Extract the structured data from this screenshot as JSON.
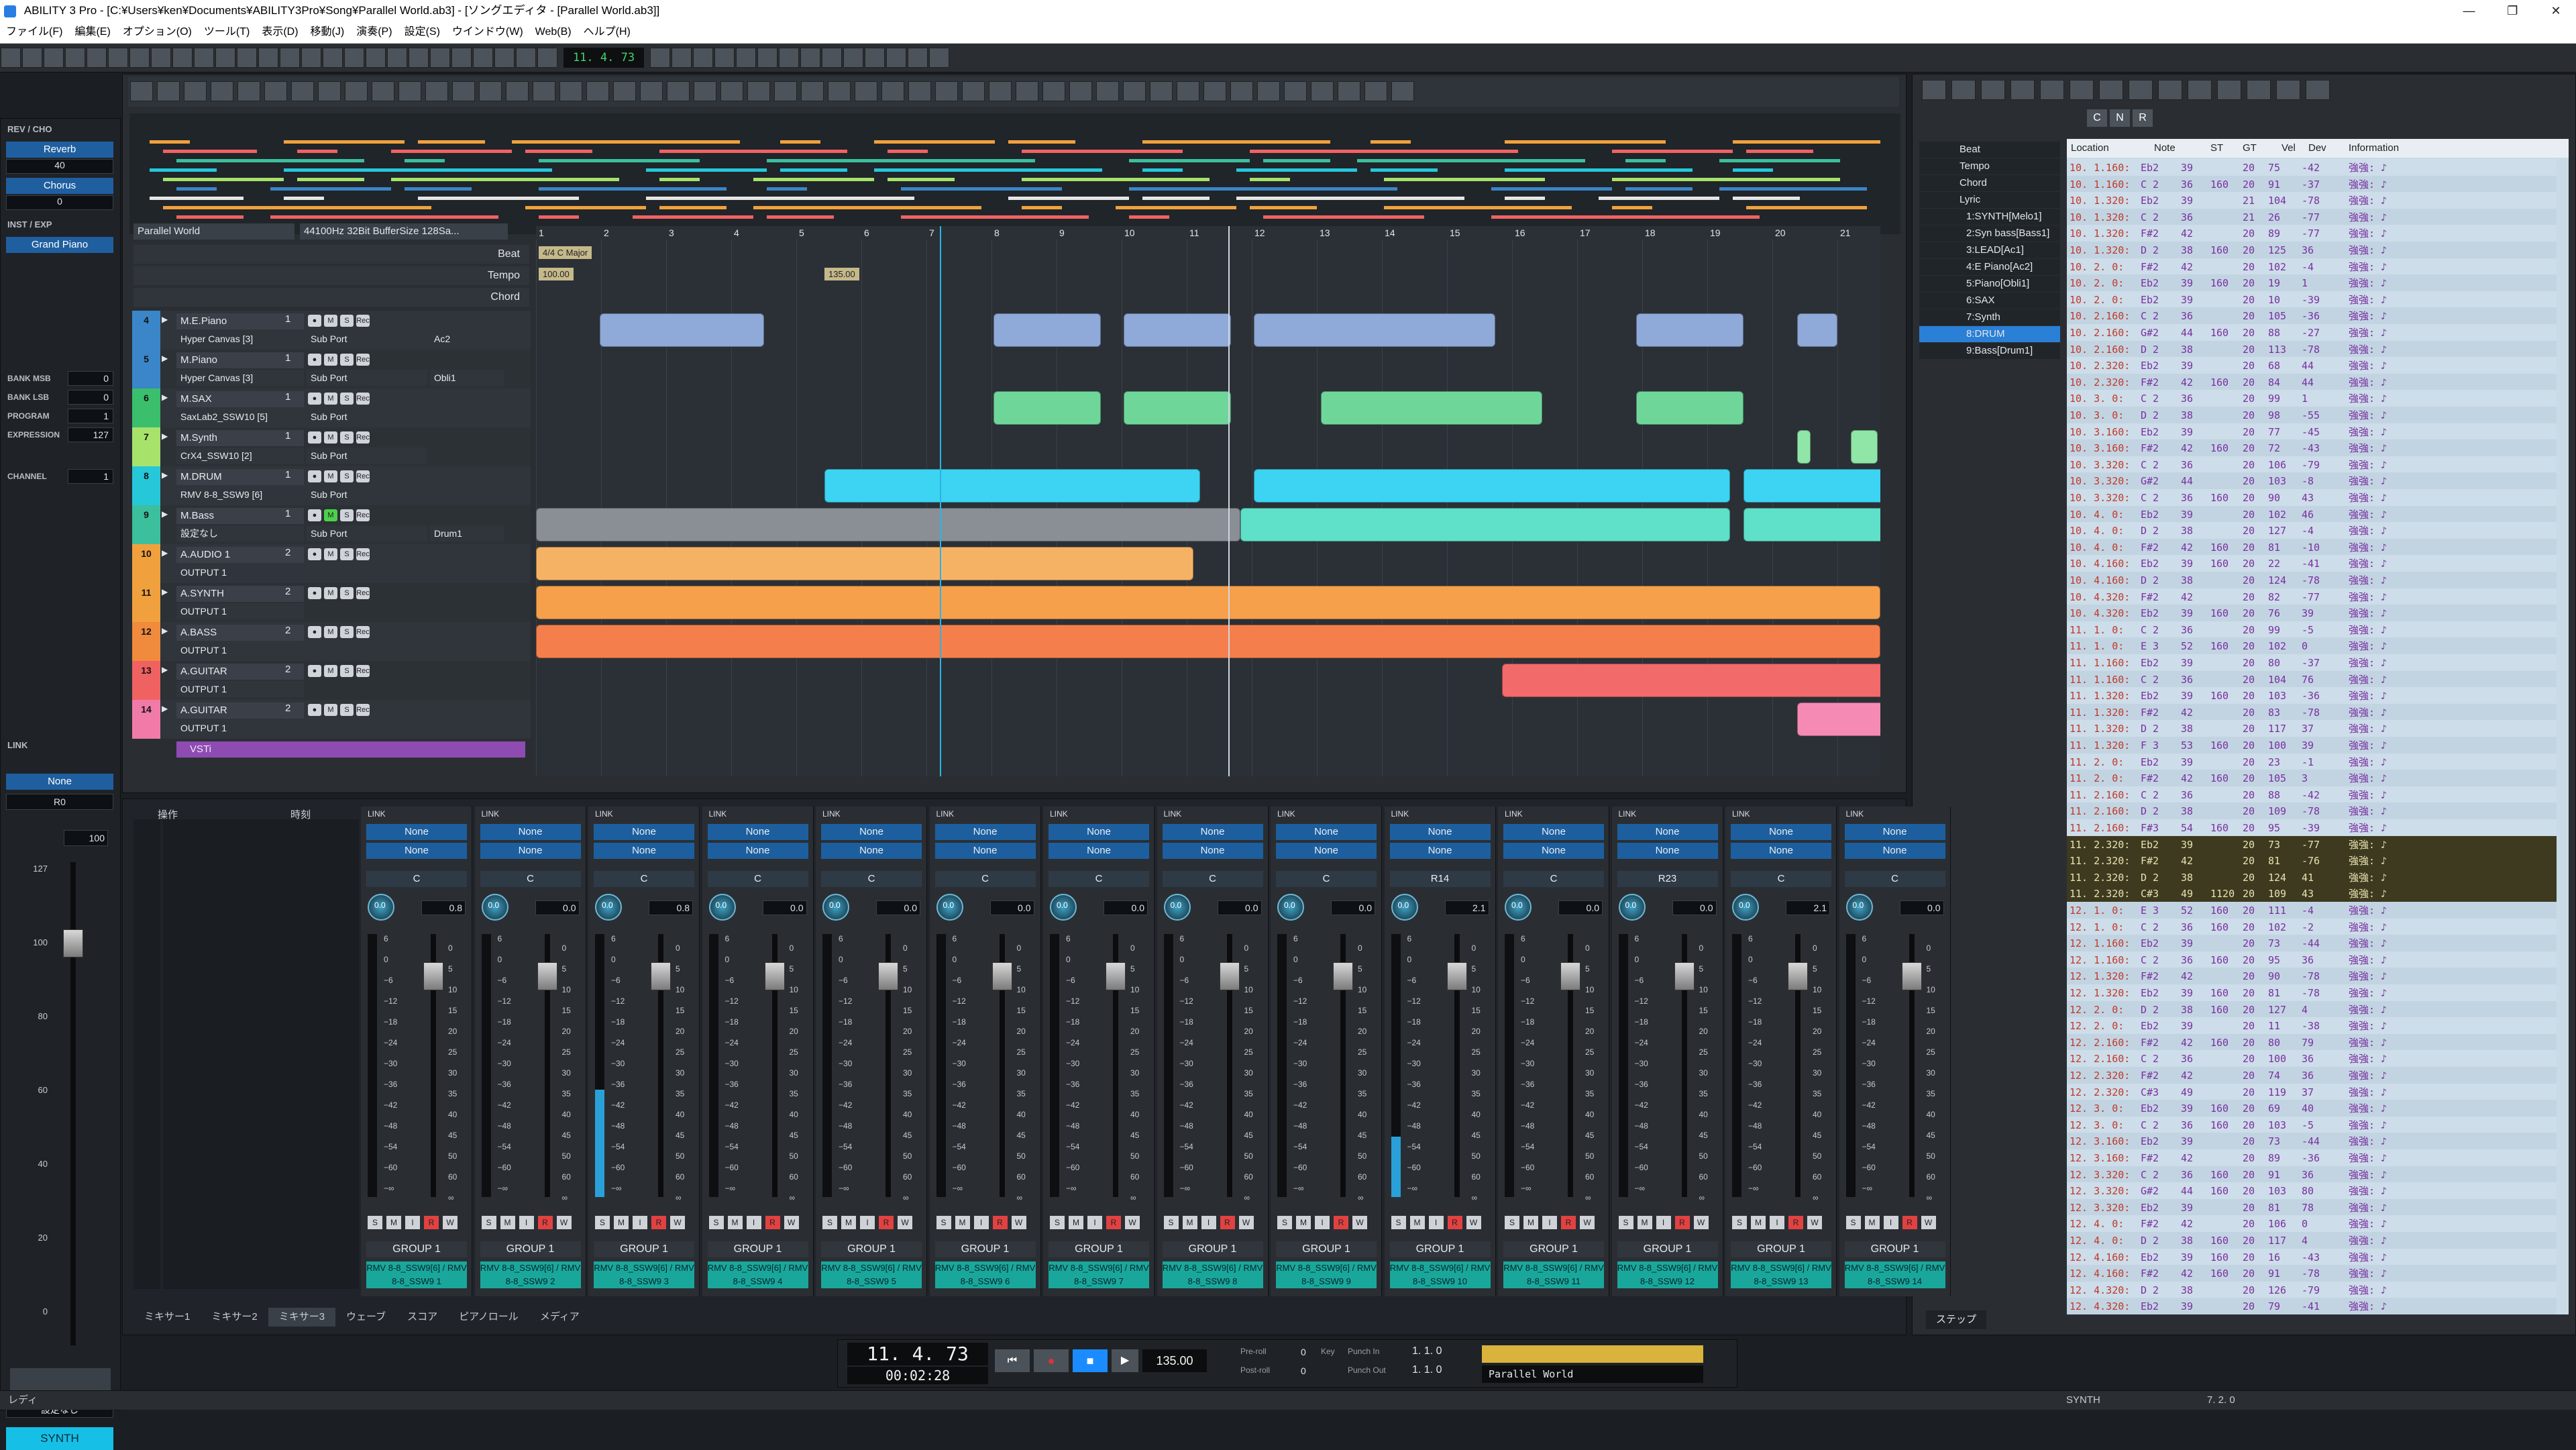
{
  "window": {
    "title": "ABILITY 3 Pro - [C:¥Users¥ken¥Documents¥ABILITY3Pro¥Song¥Parallel World.ab3] - [ソングエディタ - [Parallel World.ab3]]",
    "min": "—",
    "max": "❐",
    "close": "✕"
  },
  "menu": [
    "ファイル(F)",
    "編集(E)",
    "オプション(O)",
    "ツール(T)",
    "表示(D)",
    "移動(J)",
    "演奏(P)",
    "設定(S)",
    "ウインドウ(W)",
    "Web(B)",
    "ヘルプ(H)"
  ],
  "toolbar": {
    "position": "11. 4. 73"
  },
  "inspector": {
    "rev_cho": "REV / CHO",
    "reverb_label": "Reverb",
    "reverb_value": "40",
    "chorus_label": "Chorus",
    "chorus_value": "0",
    "inst_exp": "INST / EXP",
    "instrument": "Grand Piano",
    "params": [
      {
        "label": "BANK MSB",
        "value": "0"
      },
      {
        "label": "BANK LSB",
        "value": "0"
      },
      {
        "label": "PROGRAM",
        "value": "1"
      },
      {
        "label": "EXPRESSION",
        "value": "127"
      },
      {
        "label": "CHANNEL",
        "value": "1"
      }
    ],
    "link": "LINK",
    "none": "None",
    "pan": "R0",
    "volume": "100",
    "scale": [
      "127",
      "100",
      "80",
      "60",
      "40",
      "20",
      "0"
    ],
    "setting": "設定なし",
    "synth": "SYNTH"
  },
  "song": {
    "title": "Parallel World",
    "format": "44100Hz 32Bit BufferSize 128Sa...",
    "rulers": [
      "Beat",
      "Tempo",
      "Chord"
    ],
    "beat_label": "4/4 C Major",
    "tempo1": "100.00",
    "tempo2": "135.00",
    "bars": [
      "1",
      "2",
      "3",
      "4",
      "5",
      "6",
      "7",
      "8",
      "9",
      "10",
      "11",
      "12",
      "13",
      "14",
      "15",
      "16",
      "17",
      "18",
      "19",
      "20",
      "21"
    ],
    "tracks": [
      {
        "num": "4",
        "name": "M.E.Piano",
        "ch": "1",
        "inst": "Hyper Canvas [3]",
        "port": "Sub Port",
        "extra": "Ac2",
        "color": "#3a86c8"
      },
      {
        "num": "5",
        "name": "M.Piano",
        "ch": "1",
        "inst": "Hyper Canvas [3]",
        "port": "Sub Port",
        "extra": "Obli1",
        "color": "#3a86c8"
      },
      {
        "num": "6",
        "name": "M.SAX",
        "ch": "1",
        "inst": "SaxLab2_SSW10 [5]",
        "port": "Sub Port",
        "extra": "",
        "color": "#3bbf6d"
      },
      {
        "num": "7",
        "name": "M.Synth",
        "ch": "1",
        "inst": "CrX4_SSW10 [2]",
        "port": "Sub Port",
        "extra": "",
        "color": "#a7e36a"
      },
      {
        "num": "8",
        "name": "M.DRUM",
        "ch": "1",
        "inst": "RMV 8-8_SSW9 [6]",
        "port": "Sub Port",
        "extra": "",
        "color": "#26c7d9"
      },
      {
        "num": "9",
        "name": "M.Bass",
        "ch": "1",
        "inst": "設定なし",
        "port": "Sub Port",
        "extra": "Drum1",
        "color": "#3bbf9c"
      },
      {
        "num": "10",
        "name": "A.AUDIO 1",
        "ch": "2",
        "inst": "OUTPUT 1",
        "port": "",
        "extra": "",
        "color": "#f0a13d"
      },
      {
        "num": "11",
        "name": "A.SYNTH",
        "ch": "2",
        "inst": "OUTPUT 1",
        "port": "",
        "extra": "",
        "color": "#f0a13d"
      },
      {
        "num": "12",
        "name": "A.BASS",
        "ch": "2",
        "inst": "OUTPUT 1",
        "port": "",
        "extra": "",
        "color": "#f08a3d"
      },
      {
        "num": "13",
        "name": "A.GUITAR",
        "ch": "2",
        "inst": "OUTPUT 1",
        "port": "",
        "extra": "",
        "color": "#f06262"
      },
      {
        "num": "14",
        "name": "A.GUITAR",
        "ch": "2",
        "inst": "OUTPUT 1",
        "port": "",
        "extra": "",
        "color": "#f07aa8"
      }
    ],
    "vsti": "VSTi",
    "ms": [
      "●",
      "M",
      "S",
      "Rec",
      "A",
      "C"
    ]
  },
  "mixer": {
    "header_op": "操作",
    "header_time": "時刻",
    "strips": [
      {
        "pan": "C",
        "knob": "0.0",
        "val": "0.8",
        "plug": "RMV 8-8_SSW9[6] / RMV 8-8_SSW9 1"
      },
      {
        "pan": "C",
        "knob": "0.0",
        "val": "0.0",
        "plug": "RMV 8-8_SSW9[6] / RMV 8-8_SSW9 2"
      },
      {
        "pan": "C",
        "knob": "0.0",
        "val": "0.8",
        "plug": "RMV 8-8_SSW9[6] / RMV 8-8_SSW9 3"
      },
      {
        "pan": "C",
        "knob": "0.0",
        "val": "0.0",
        "plug": "RMV 8-8_SSW9[6] / RMV 8-8_SSW9 4"
      },
      {
        "pan": "C",
        "knob": "0.0",
        "val": "0.0",
        "plug": "RMV 8-8_SSW9[6] / RMV 8-8_SSW9 5"
      },
      {
        "pan": "C",
        "knob": "0.0",
        "val": "0.0",
        "plug": "RMV 8-8_SSW9[6] / RMV 8-8_SSW9 6"
      },
      {
        "pan": "C",
        "knob": "0.0",
        "val": "0.0",
        "plug": "RMV 8-8_SSW9[6] / RMV 8-8_SSW9 7"
      },
      {
        "pan": "C",
        "knob": "0.0",
        "val": "0.0",
        "plug": "RMV 8-8_SSW9[6] / RMV 8-8_SSW9 8"
      },
      {
        "pan": "C",
        "knob": "0.0",
        "val": "0.0",
        "plug": "RMV 8-8_SSW9[6] / RMV 8-8_SSW9 9"
      },
      {
        "pan": "R14",
        "knob": "0.0",
        "val": "2.1",
        "plug": "RMV 8-8_SSW9[6] / RMV 8-8_SSW9 10"
      },
      {
        "pan": "C",
        "knob": "0.0",
        "val": "0.0",
        "plug": "RMV 8-8_SSW9[6] / RMV 8-8_SSW9 11"
      },
      {
        "pan": "R23",
        "knob": "0.0",
        "val": "0.0",
        "plug": "RMV 8-8_SSW9[6] / RMV 8-8_SSW9 12"
      },
      {
        "pan": "C",
        "knob": "0.0",
        "val": "2.1",
        "plug": "RMV 8-8_SSW9[6] / RMV 8-8_SSW9 13"
      },
      {
        "pan": "C",
        "knob": "0.0",
        "val": "0.0",
        "plug": "RMV 8-8_SSW9[6] / RMV 8-8_SSW9 14"
      }
    ],
    "link": "LINK",
    "none": "None",
    "group": "GROUP 1",
    "scale": [
      "6",
      "0",
      "−6",
      "−12",
      "−18",
      "−24",
      "−30",
      "−36",
      "−42",
      "−48",
      "−54",
      "−60",
      "−∞"
    ],
    "scale_r": [
      "0",
      "5",
      "10",
      "15",
      "20",
      "25",
      "30",
      "35",
      "40",
      "45",
      "50",
      "60",
      "∞"
    ],
    "srw": [
      "S",
      "M",
      "I",
      "R",
      "W"
    ]
  },
  "tabs": [
    "ミキサー1",
    "ミキサー2",
    "ミキサー3",
    "ウェーブ",
    "スコア",
    "ピアノロール",
    "メディア"
  ],
  "event_list": {
    "headers": [
      "Location",
      "Note",
      "ST",
      "GT",
      "Vel",
      "Dev",
      "Information"
    ],
    "tracks": [
      "Beat",
      "Tempo",
      "Chord",
      "Lyric",
      "1:SYNTH[Melo1]",
      "2:Syn bass[Bass1]",
      "3:LEAD[Ac1]",
      "4:E Piano[Ac2]",
      "5:Piano[Obli1]",
      "6:SAX",
      "7:Synth",
      "8:DRUM",
      "9:Bass[Drum1]"
    ],
    "tool_labels": [
      "C",
      "N",
      "R"
    ],
    "rows": [
      [
        "10. 1.160:",
        "Eb2",
        "39",
        "",
        "20",
        "75",
        "-42",
        "強強: ♪"
      ],
      [
        "10. 1.160:",
        "C 2",
        "36",
        "160",
        "20",
        "91",
        "-37",
        "強強: ♪"
      ],
      [
        "10. 1.320:",
        "Eb2",
        "39",
        "",
        "21",
        "104",
        "-78",
        "強強: ♪"
      ],
      [
        "10. 1.320:",
        "C 2",
        "36",
        "",
        "21",
        "26",
        "-77",
        "強強: ♪"
      ],
      [
        "10. 1.320:",
        "F#2",
        "42",
        "",
        "20",
        "89",
        "-77",
        "強強: ♪"
      ],
      [
        "10. 1.320:",
        "D 2",
        "38",
        "160",
        "20",
        "125",
        "36",
        "強強: ♪"
      ],
      [
        "10. 2. 0:",
        "F#2",
        "42",
        "",
        "20",
        "102",
        "-4",
        "強強: ♪"
      ],
      [
        "10. 2. 0:",
        "Eb2",
        "39",
        "160",
        "20",
        "19",
        "1",
        "強強: ♪"
      ],
      [
        "10. 2. 0:",
        "Eb2",
        "39",
        "",
        "20",
        "10",
        "-39",
        "強強: ♪"
      ],
      [
        "10. 2.160:",
        "C 2",
        "36",
        "",
        "20",
        "105",
        "-36",
        "強強: ♪"
      ],
      [
        "10. 2.160:",
        "G#2",
        "44",
        "160",
        "20",
        "88",
        "-27",
        "強強: ♪"
      ],
      [
        "10. 2.160:",
        "D 2",
        "38",
        "",
        "20",
        "113",
        "-78",
        "強強: ♪"
      ],
      [
        "10. 2.320:",
        "Eb2",
        "39",
        "",
        "20",
        "68",
        "44",
        "強強: ♪"
      ],
      [
        "10. 2.320:",
        "F#2",
        "42",
        "160",
        "20",
        "84",
        "44",
        "強強: ♪"
      ],
      [
        "10. 3. 0:",
        "C 2",
        "36",
        "",
        "20",
        "99",
        "1",
        "強強: ♪"
      ],
      [
        "10. 3. 0:",
        "D 2",
        "38",
        "",
        "20",
        "98",
        "-55",
        "強強: ♪"
      ],
      [
        "10. 3.160:",
        "Eb2",
        "39",
        "",
        "20",
        "77",
        "-45",
        "強強: ♪"
      ],
      [
        "10. 3.160:",
        "F#2",
        "42",
        "160",
        "20",
        "72",
        "-43",
        "強強: ♪"
      ],
      [
        "10. 3.320:",
        "C 2",
        "36",
        "",
        "20",
        "106",
        "-79",
        "強強: ♪"
      ],
      [
        "10. 3.320:",
        "G#2",
        "44",
        "",
        "20",
        "103",
        "-8",
        "強強: ♪"
      ],
      [
        "10. 3.320:",
        "C 2",
        "36",
        "160",
        "20",
        "90",
        "43",
        "強強: ♪"
      ],
      [
        "10. 4. 0:",
        "Eb2",
        "39",
        "",
        "20",
        "102",
        "46",
        "強強: ♪"
      ],
      [
        "10. 4. 0:",
        "D 2",
        "38",
        "",
        "20",
        "127",
        "-4",
        "強強: ♪"
      ],
      [
        "10. 4. 0:",
        "F#2",
        "42",
        "160",
        "20",
        "81",
        "-10",
        "強強: ♪"
      ],
      [
        "10. 4.160:",
        "Eb2",
        "39",
        "160",
        "20",
        "22",
        "-41",
        "強強: ♪"
      ],
      [
        "10. 4.160:",
        "D 2",
        "38",
        "",
        "20",
        "124",
        "-78",
        "強強: ♪"
      ],
      [
        "10. 4.320:",
        "F#2",
        "42",
        "",
        "20",
        "82",
        "-77",
        "強強: ♪"
      ],
      [
        "10. 4.320:",
        "Eb2",
        "39",
        "160",
        "20",
        "76",
        "39",
        "強強: ♪"
      ],
      [
        "11. 1. 0:",
        "C 2",
        "36",
        "",
        "20",
        "99",
        "-5",
        "強強: ♪"
      ],
      [
        "11. 1. 0:",
        "E 3",
        "52",
        "160",
        "20",
        "102",
        "0",
        "強強: ♪"
      ],
      [
        "11. 1.160:",
        "Eb2",
        "39",
        "",
        "20",
        "80",
        "-37",
        "強強: ♪"
      ],
      [
        "11. 1.160:",
        "C 2",
        "36",
        "",
        "20",
        "104",
        "76",
        "強強: ♪"
      ],
      [
        "11. 1.320:",
        "Eb2",
        "39",
        "160",
        "20",
        "103",
        "-36",
        "強強: ♪"
      ],
      [
        "11. 1.320:",
        "F#2",
        "42",
        "",
        "20",
        "83",
        "-78",
        "強強: ♪"
      ],
      [
        "11. 1.320:",
        "D 2",
        "38",
        "",
        "20",
        "117",
        "37",
        "強強: ♪"
      ],
      [
        "11. 1.320:",
        "F 3",
        "53",
        "160",
        "20",
        "100",
        "39",
        "強強: ♪"
      ],
      [
        "11. 2. 0:",
        "Eb2",
        "39",
        "",
        "20",
        "23",
        "-1",
        "強強: ♪"
      ],
      [
        "11. 2. 0:",
        "F#2",
        "42",
        "160",
        "20",
        "105",
        "3",
        "強強: ♪"
      ],
      [
        "11. 2.160:",
        "C 2",
        "36",
        "",
        "20",
        "88",
        "-42",
        "強強: ♪"
      ],
      [
        "11. 2.160:",
        "D 2",
        "38",
        "",
        "20",
        "109",
        "-78",
        "強強: ♪"
      ],
      [
        "11. 2.160:",
        "F#3",
        "54",
        "160",
        "20",
        "95",
        "-39",
        "強強: ♪"
      ],
      [
        "11. 2.320:",
        "Eb2",
        "39",
        "",
        "20",
        "73",
        "-77",
        "強強: ♪"
      ],
      [
        "11. 2.320:",
        "F#2",
        "42",
        "",
        "20",
        "81",
        "-76",
        "強強: ♪"
      ],
      [
        "11. 2.320:",
        "D 2",
        "38",
        "",
        "20",
        "124",
        "41",
        "強強: ♪"
      ],
      [
        "11. 2.320:",
        "C#3",
        "49",
        "1120",
        "20",
        "109",
        "43",
        "強強: ♪"
      ],
      [
        "12. 1. 0:",
        "E 3",
        "52",
        "160",
        "20",
        "111",
        "-4",
        "強強: ♪"
      ],
      [
        "12. 1. 0:",
        "C 2",
        "36",
        "160",
        "20",
        "102",
        "-2",
        "強強: ♪"
      ],
      [
        "12. 1.160:",
        "Eb2",
        "39",
        "",
        "20",
        "73",
        "-44",
        "強強: ♪"
      ],
      [
        "12. 1.160:",
        "C 2",
        "36",
        "160",
        "20",
        "95",
        "36",
        "強強: ♪"
      ],
      [
        "12. 1.320:",
        "F#2",
        "42",
        "",
        "20",
        "90",
        "-78",
        "強強: ♪"
      ],
      [
        "12. 1.320:",
        "Eb2",
        "39",
        "160",
        "20",
        "81",
        "-78",
        "強強: ♪"
      ],
      [
        "12. 2. 0:",
        "D 2",
        "38",
        "160",
        "20",
        "127",
        "4",
        "強強: ♪"
      ],
      [
        "12. 2. 0:",
        "Eb2",
        "39",
        "",
        "20",
        "11",
        "-38",
        "強強: ♪"
      ],
      [
        "12. 2.160:",
        "F#2",
        "42",
        "160",
        "20",
        "80",
        "79",
        "強強: ♪"
      ],
      [
        "12. 2.160:",
        "C 2",
        "36",
        "",
        "20",
        "100",
        "36",
        "強強: ♪"
      ],
      [
        "12. 2.320:",
        "F#2",
        "42",
        "",
        "20",
        "74",
        "36",
        "強強: ♪"
      ],
      [
        "12. 2.320:",
        "C#3",
        "49",
        "",
        "20",
        "119",
        "37",
        "強強: ♪"
      ],
      [
        "12. 3. 0:",
        "Eb2",
        "39",
        "160",
        "20",
        "69",
        "40",
        "強強: ♪"
      ],
      [
        "12. 3. 0:",
        "C 2",
        "36",
        "160",
        "20",
        "103",
        "-5",
        "強強: ♪"
      ],
      [
        "12. 3.160:",
        "Eb2",
        "39",
        "",
        "20",
        "73",
        "-44",
        "強強: ♪"
      ],
      [
        "12. 3.160:",
        "F#2",
        "42",
        "",
        "20",
        "89",
        "-36",
        "強強: ♪"
      ],
      [
        "12. 3.320:",
        "C 2",
        "36",
        "160",
        "20",
        "91",
        "36",
        "強強: ♪"
      ],
      [
        "12. 3.320:",
        "G#2",
        "44",
        "160",
        "20",
        "103",
        "80",
        "強強: ♪"
      ],
      [
        "12. 3.320:",
        "Eb2",
        "39",
        "",
        "20",
        "81",
        "78",
        "強強: ♪"
      ],
      [
        "12. 4. 0:",
        "F#2",
        "42",
        "",
        "20",
        "106",
        "0",
        "強強: ♪"
      ],
      [
        "12. 4. 0:",
        "D 2",
        "38",
        "160",
        "20",
        "117",
        "4",
        "強強: ♪"
      ],
      [
        "12. 4.160:",
        "Eb2",
        "39",
        "160",
        "20",
        "16",
        "-43",
        "強強: ♪"
      ],
      [
        "12. 4.160:",
        "F#2",
        "42",
        "160",
        "20",
        "91",
        "-78",
        "強強: ♪"
      ],
      [
        "12. 4.320:",
        "D 2",
        "38",
        "",
        "20",
        "126",
        "-79",
        "強強: ♪"
      ],
      [
        "12. 4.320:",
        "Eb2",
        "39",
        "",
        "20",
        "79",
        "-41",
        "強強: ♪"
      ]
    ],
    "step_tab": "ステップ"
  },
  "transport": {
    "position": "11. 4. 73",
    "time": "00:02:28",
    "tempo": "135.00",
    "preroll": "Pre-roll",
    "postroll": "Post-roll",
    "preroll_val": "0",
    "postroll_val": "0",
    "key": "Key",
    "punchin": "Punch In",
    "punchout": "Punch Out",
    "punchin_val": "1. 1. 0",
    "punchout_val": "1. 1. 0",
    "song": "Parallel World"
  },
  "status": {
    "left": "レディ",
    "mid": "SYNTH",
    "right": "7. 2. 0"
  },
  "colors": {
    "accent": "#1f5fa0",
    "meter": "#2aa0d8",
    "panel": "#23272c"
  }
}
